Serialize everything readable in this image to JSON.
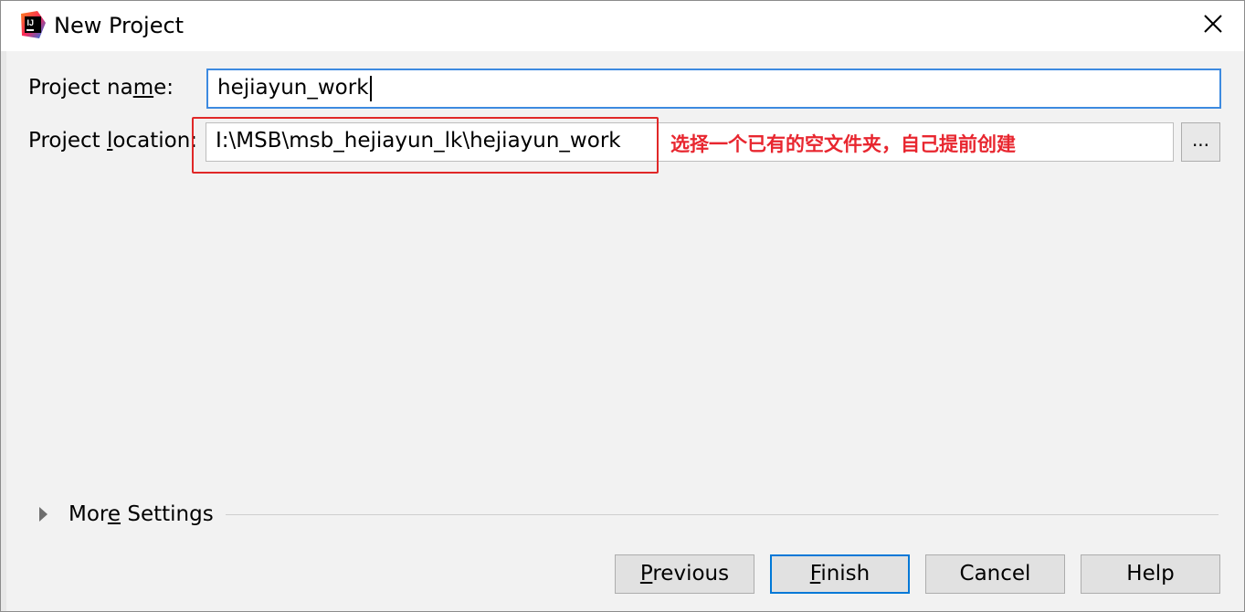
{
  "window": {
    "title": "New Project"
  },
  "form": {
    "project_name_label_pre": "Project na",
    "project_name_label_mnemonic": "m",
    "project_name_label_post": "e:",
    "project_name_value": "hejiayun_work",
    "project_location_label_pre": "Project ",
    "project_location_label_mnemonic": "l",
    "project_location_label_post": "ocation:",
    "project_location_value": "I:\\MSB\\msb_hejiayun_lk\\hejiayun_work",
    "browse_label": "..."
  },
  "annotation": {
    "text": "选择一个已有的空文件夹，自己提前创建",
    "color": "#e8262f"
  },
  "more_settings": {
    "label_pre": "Mor",
    "label_mnemonic": "e",
    "label_post": " Settings"
  },
  "buttons": {
    "previous_mnemonic": "P",
    "previous_rest": "revious",
    "finish_mnemonic": "F",
    "finish_rest": "inish",
    "cancel_label": "Cancel",
    "help_label": "Help"
  },
  "icons": {
    "app": "intellij-idea-icon",
    "close": "close-icon",
    "expand": "triangle-right-icon"
  },
  "colors": {
    "focus_border": "#3d8ae0",
    "primary_button_border": "#0078d7",
    "highlight_box": "#e02828"
  }
}
